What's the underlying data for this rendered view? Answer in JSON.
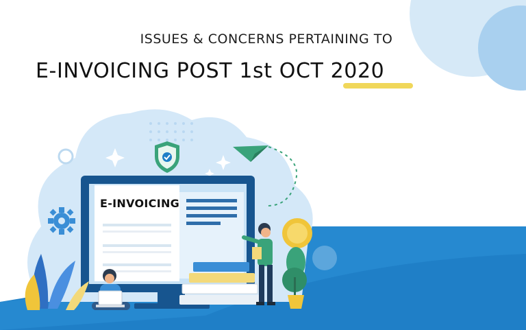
{
  "heading": {
    "line1": "ISSUES & CONCERNS PERTAINING TO",
    "line2": "E-INVOICING POST 1st OCT ",
    "year": "2020"
  },
  "screen": {
    "document_title": "E-INVOICING"
  },
  "icons": [
    "shield-check-icon",
    "paper-plane-icon",
    "gear-icon",
    "sparkle-icon",
    "coin-icon",
    "plant-icon",
    "laptop-icon"
  ],
  "colors": {
    "accent_blue": "#1f7fc7",
    "light_blue": "#d7eaf8",
    "highlight_yellow": "#f0d75a",
    "green": "#3aa37a"
  }
}
